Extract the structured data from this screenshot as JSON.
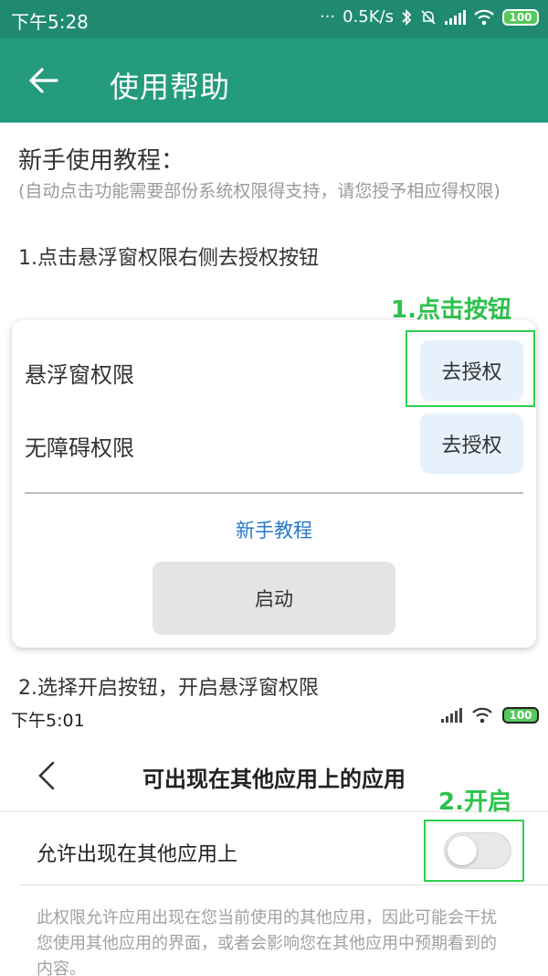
{
  "status_bar": {
    "time": "下午5:28",
    "network_speed": "0.5K/s",
    "battery": "100",
    "icons": [
      "bluetooth-icon",
      "mute-icon",
      "signal-icon",
      "wifi-icon",
      "battery-icon"
    ]
  },
  "app_bar": {
    "title": "使用帮助",
    "back_icon": "arrow-left-icon"
  },
  "intro": {
    "heading": "新手使用教程：",
    "note": "(自动点击功能需要部份系统权限得支持，请您授予相应得权限)"
  },
  "step1": {
    "text": "1.点击悬浮窗权限右侧去授权按钮",
    "card": {
      "rows": [
        {
          "label": "悬浮窗权限",
          "button": "去授权"
        },
        {
          "label": "无障碍权限",
          "button": "去授权"
        }
      ],
      "tutorial_link": "新手教程",
      "start_button": "启动"
    },
    "annotation": "1.点击按钮"
  },
  "step2": {
    "text": "2.选择开启按钮，开启悬浮窗权限",
    "screenshot": {
      "time": "下午5:01",
      "battery": "100",
      "title": "可出现在其他应用上的应用",
      "row_label": "允许出现在其他应用上",
      "toggle_on": false,
      "description": "此权限允许应用出现在您当前使用的其他应用，因此可能会干扰您使用其他应用的界面，或者会影响您在其他应用中预期看到的内容。"
    },
    "annotation": "2.开启"
  },
  "colors": {
    "status_bar": "#1f8a70",
    "app_bar": "#239b7c",
    "annotation": "#2dc24c",
    "link": "#2a79c9",
    "grant_button": "#e6f1fb"
  }
}
